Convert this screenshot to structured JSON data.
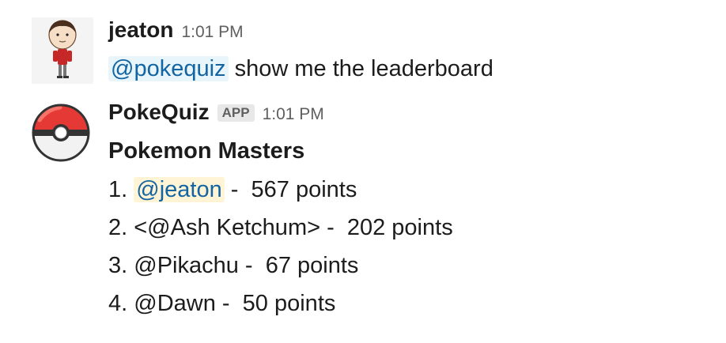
{
  "messages": [
    {
      "author": "jeaton",
      "time": "1:01 PM",
      "mention": "@pokequiz",
      "text": " show me the leaderboard"
    },
    {
      "author": "PokeQuiz",
      "badge": "APP",
      "time": "1:01 PM",
      "title": "Pokemon Masters",
      "leaderboard": [
        {
          "rank": "1. ",
          "name": "@jeaton",
          "score": " -  567 points"
        },
        {
          "rank": "2. ",
          "name": "<@Ash Ketchum>",
          "score": " -  202 points"
        },
        {
          "rank": "3. ",
          "name": "@Pikachu",
          "score": " -  67 points"
        },
        {
          "rank": "4. ",
          "name": "@Dawn",
          "score": " -  50 points"
        }
      ]
    }
  ],
  "colors": {
    "mention_text": "#1264a3",
    "mention_bg": "#e8f5fa",
    "self_mention_bg": "#fff4d6",
    "pokeball_red": "#e53935"
  },
  "icons": {
    "user_avatar": "cartoon-person-avatar",
    "bot_avatar": "pokeball-icon"
  }
}
